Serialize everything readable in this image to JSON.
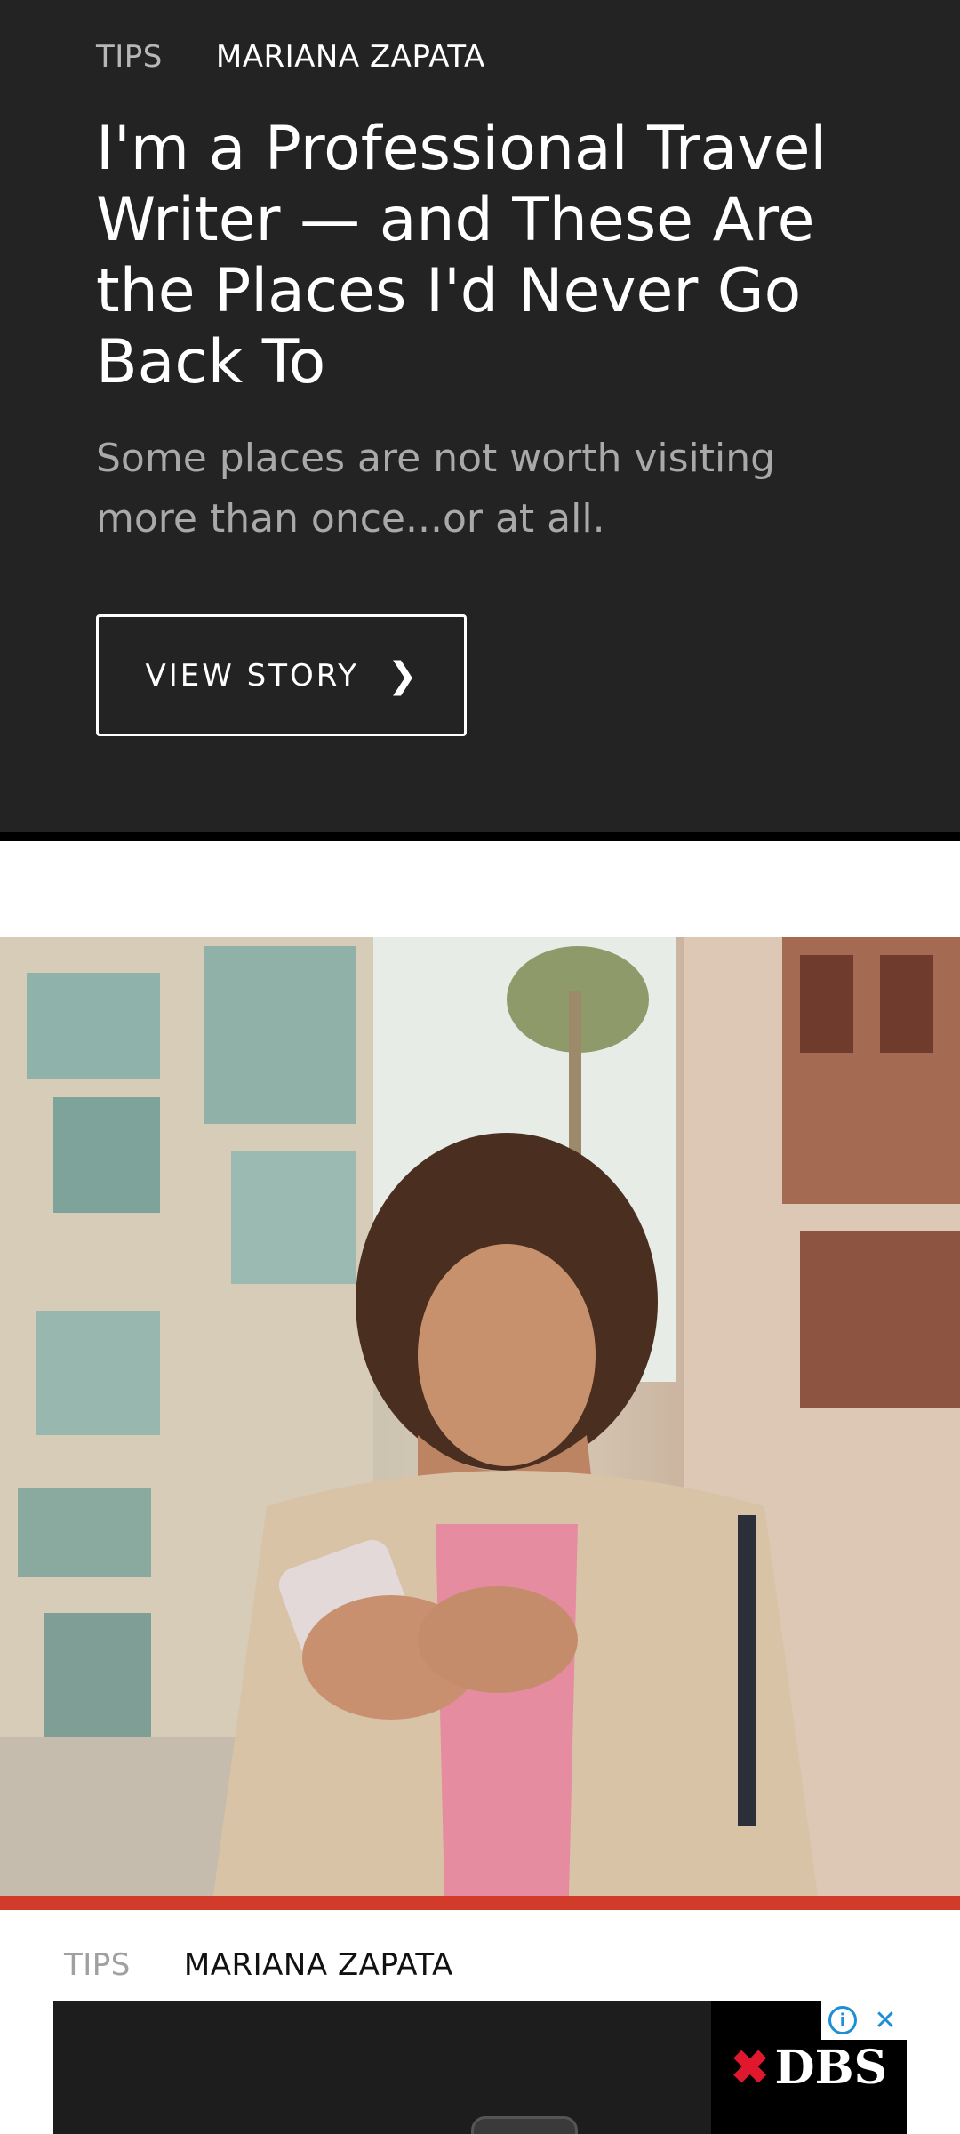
{
  "hero": {
    "category": "TIPS",
    "author": "MARIANA ZAPATA",
    "title": "I'm a Professional Travel Writer — and These Are the Places I'd Never Go Back To",
    "description": "Some places are not worth visiting more than once...or at all.",
    "button_label": "VIEW STORY",
    "button_icon": "chevron-right-icon"
  },
  "card": {
    "category": "TIPS",
    "author": "MARIANA ZAPATA",
    "accent_color": "#d23a2a"
  },
  "ad": {
    "brand": "DBS",
    "info_icon": "info-icon",
    "close_icon": "close-icon"
  }
}
